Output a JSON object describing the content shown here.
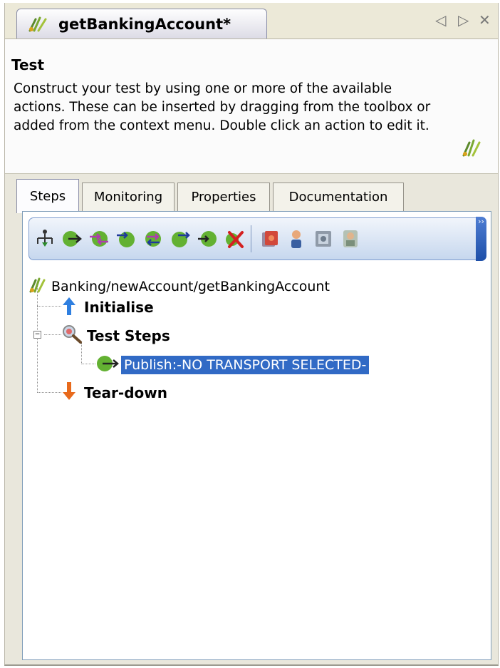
{
  "tab": {
    "title": "getBankingAccount*",
    "icon": "test-tube-icon"
  },
  "tab_controls": {
    "prev": "◁",
    "next": "▷",
    "close": "✕"
  },
  "header": {
    "title": "Test",
    "description": "Construct your test by using one or more of the available actions. These can be inserted by dragging from the toolbox or added from the context menu. Double click an action to edit it.",
    "icon": "test-tube-icon"
  },
  "subtabs": [
    "Steps",
    "Monitoring",
    "Properties",
    "Documentation"
  ],
  "active_subtab": "Steps",
  "toolbar": {
    "buttons": [
      "tree-structure-icon",
      "publish-icon",
      "subscribe-icon",
      "receive-reply-icon",
      "send-request-icon",
      "send-reply-icon",
      "receive-request-icon",
      "delete-icon",
      "error-message-icon",
      "user-icon",
      "message-inspect-icon",
      "user-switch-icon"
    ],
    "overflow": "››"
  },
  "tree": {
    "root": "Banking/newAccount/getBankingAccount",
    "initialise": "Initialise",
    "test_steps": "Test Steps",
    "publish_step": "Publish:-NO TRANSPORT SELECTED-",
    "teardown": "Tear-down"
  },
  "colors": {
    "selection": "#316ac5",
    "toolbar_border": "#7d9ccf",
    "panel_bg": "#e9e7dc"
  }
}
